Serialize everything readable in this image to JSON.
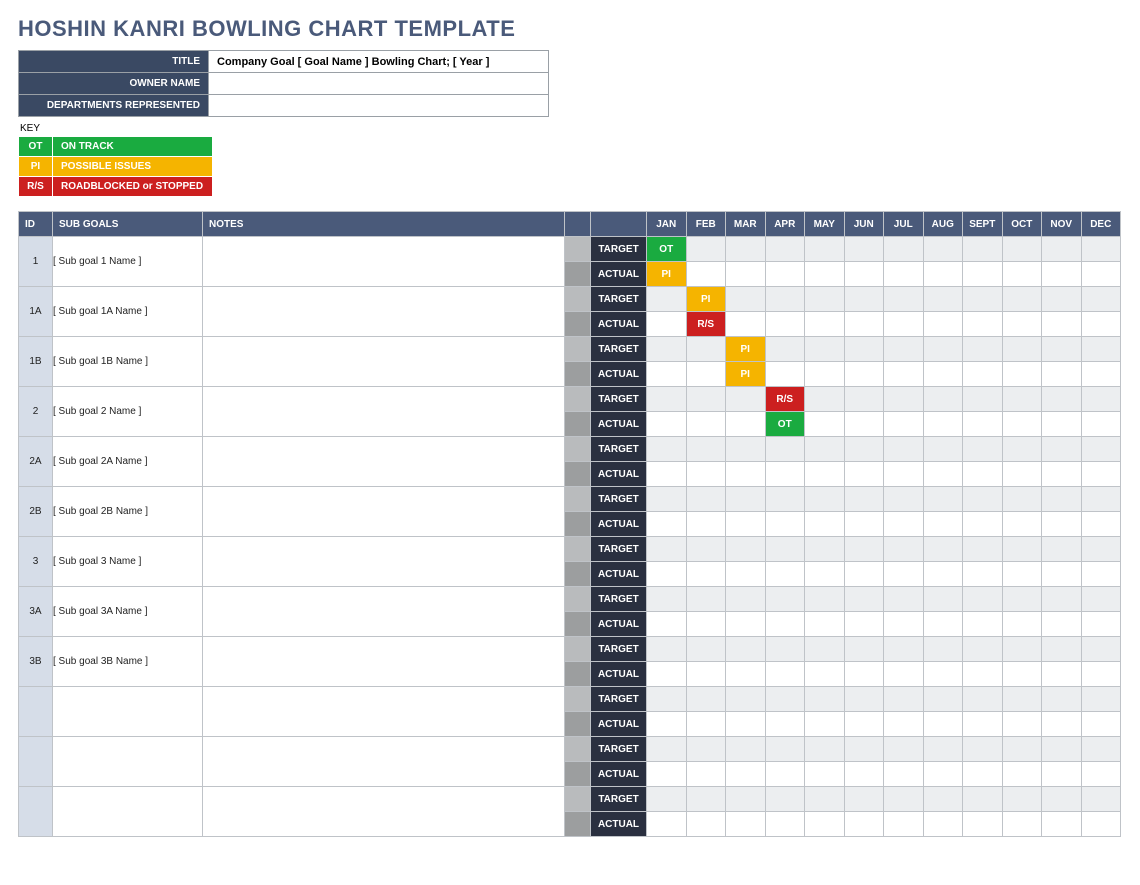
{
  "page_title": "HOSHIN KANRI BOWLING CHART TEMPLATE",
  "meta": {
    "labels": {
      "title": "TITLE",
      "owner": "OWNER NAME",
      "departments": "DEPARTMENTS REPRESENTED"
    },
    "values": {
      "title": "Company Goal [ Goal Name ] Bowling Chart; [ Year ]",
      "owner": "",
      "departments": ""
    }
  },
  "key_label": "KEY",
  "key": [
    {
      "code": "OT",
      "label": "ON TRACK",
      "class": "c-ot"
    },
    {
      "code": "PI",
      "label": "POSSIBLE ISSUES",
      "class": "c-pi"
    },
    {
      "code": "R/S",
      "label": "ROADBLOCKED or STOPPED",
      "class": "c-rs"
    }
  ],
  "grid": {
    "headers": {
      "id": "ID",
      "sub": "SUB GOALS",
      "notes": "NOTES",
      "target": "TARGET",
      "actual": "ACTUAL"
    },
    "months": [
      "JAN",
      "FEB",
      "MAR",
      "APR",
      "MAY",
      "JUN",
      "JUL",
      "AUG",
      "SEPT",
      "OCT",
      "NOV",
      "DEC"
    ],
    "rows": [
      {
        "id": "1",
        "sub": "[ Sub goal 1 Name ]",
        "target": [
          "OT",
          "",
          "",
          "",
          "",
          "",
          "",
          "",
          "",
          "",
          "",
          ""
        ],
        "actual": [
          "PI",
          "",
          "",
          "",
          "",
          "",
          "",
          "",
          "",
          "",
          "",
          ""
        ]
      },
      {
        "id": "1A",
        "sub": "[ Sub goal 1A Name ]",
        "target": [
          "",
          "PI",
          "",
          "",
          "",
          "",
          "",
          "",
          "",
          "",
          "",
          ""
        ],
        "actual": [
          "",
          "R/S",
          "",
          "",
          "",
          "",
          "",
          "",
          "",
          "",
          "",
          ""
        ]
      },
      {
        "id": "1B",
        "sub": "[ Sub goal 1B Name ]",
        "target": [
          "",
          "",
          "PI",
          "",
          "",
          "",
          "",
          "",
          "",
          "",
          "",
          ""
        ],
        "actual": [
          "",
          "",
          "PI",
          "",
          "",
          "",
          "",
          "",
          "",
          "",
          "",
          ""
        ]
      },
      {
        "id": "2",
        "sub": "[ Sub goal 2 Name ]",
        "target": [
          "",
          "",
          "",
          "R/S",
          "",
          "",
          "",
          "",
          "",
          "",
          "",
          ""
        ],
        "actual": [
          "",
          "",
          "",
          "OT",
          "",
          "",
          "",
          "",
          "",
          "",
          "",
          ""
        ]
      },
      {
        "id": "2A",
        "sub": "[ Sub goal 2A Name ]",
        "target": [
          "",
          "",
          "",
          "",
          "",
          "",
          "",
          "",
          "",
          "",
          "",
          ""
        ],
        "actual": [
          "",
          "",
          "",
          "",
          "",
          "",
          "",
          "",
          "",
          "",
          "",
          ""
        ]
      },
      {
        "id": "2B",
        "sub": "[ Sub goal 2B Name ]",
        "target": [
          "",
          "",
          "",
          "",
          "",
          "",
          "",
          "",
          "",
          "",
          "",
          ""
        ],
        "actual": [
          "",
          "",
          "",
          "",
          "",
          "",
          "",
          "",
          "",
          "",
          "",
          ""
        ]
      },
      {
        "id": "3",
        "sub": "[ Sub goal 3 Name ]",
        "target": [
          "",
          "",
          "",
          "",
          "",
          "",
          "",
          "",
          "",
          "",
          "",
          ""
        ],
        "actual": [
          "",
          "",
          "",
          "",
          "",
          "",
          "",
          "",
          "",
          "",
          "",
          ""
        ]
      },
      {
        "id": "3A",
        "sub": "[ Sub goal 3A Name ]",
        "target": [
          "",
          "",
          "",
          "",
          "",
          "",
          "",
          "",
          "",
          "",
          "",
          ""
        ],
        "actual": [
          "",
          "",
          "",
          "",
          "",
          "",
          "",
          "",
          "",
          "",
          "",
          ""
        ]
      },
      {
        "id": "3B",
        "sub": "[ Sub goal 3B Name ]",
        "target": [
          "",
          "",
          "",
          "",
          "",
          "",
          "",
          "",
          "",
          "",
          "",
          ""
        ],
        "actual": [
          "",
          "",
          "",
          "",
          "",
          "",
          "",
          "",
          "",
          "",
          "",
          ""
        ]
      },
      {
        "id": "",
        "sub": "",
        "target": [
          "",
          "",
          "",
          "",
          "",
          "",
          "",
          "",
          "",
          "",
          "",
          ""
        ],
        "actual": [
          "",
          "",
          "",
          "",
          "",
          "",
          "",
          "",
          "",
          "",
          "",
          ""
        ]
      },
      {
        "id": "",
        "sub": "",
        "target": [
          "",
          "",
          "",
          "",
          "",
          "",
          "",
          "",
          "",
          "",
          "",
          ""
        ],
        "actual": [
          "",
          "",
          "",
          "",
          "",
          "",
          "",
          "",
          "",
          "",
          "",
          ""
        ]
      },
      {
        "id": "",
        "sub": "",
        "target": [
          "",
          "",
          "",
          "",
          "",
          "",
          "",
          "",
          "",
          "",
          "",
          ""
        ],
        "actual": [
          "",
          "",
          "",
          "",
          "",
          "",
          "",
          "",
          "",
          "",
          "",
          ""
        ]
      }
    ]
  },
  "chart_data": {
    "type": "table",
    "title": "Hoshin Kanri Bowling Chart Template",
    "months": [
      "JAN",
      "FEB",
      "MAR",
      "APR",
      "MAY",
      "JUN",
      "JUL",
      "AUG",
      "SEPT",
      "OCT",
      "NOV",
      "DEC"
    ],
    "legend": {
      "OT": "ON TRACK",
      "PI": "POSSIBLE ISSUES",
      "R/S": "ROADBLOCKED or STOPPED"
    },
    "series": [
      {
        "name": "Sub goal 1 Target",
        "values": [
          "OT",
          null,
          null,
          null,
          null,
          null,
          null,
          null,
          null,
          null,
          null,
          null
        ]
      },
      {
        "name": "Sub goal 1 Actual",
        "values": [
          "PI",
          null,
          null,
          null,
          null,
          null,
          null,
          null,
          null,
          null,
          null,
          null
        ]
      },
      {
        "name": "Sub goal 1A Target",
        "values": [
          null,
          "PI",
          null,
          null,
          null,
          null,
          null,
          null,
          null,
          null,
          null,
          null
        ]
      },
      {
        "name": "Sub goal 1A Actual",
        "values": [
          null,
          "R/S",
          null,
          null,
          null,
          null,
          null,
          null,
          null,
          null,
          null,
          null
        ]
      },
      {
        "name": "Sub goal 1B Target",
        "values": [
          null,
          null,
          "PI",
          null,
          null,
          null,
          null,
          null,
          null,
          null,
          null,
          null
        ]
      },
      {
        "name": "Sub goal 1B Actual",
        "values": [
          null,
          null,
          "PI",
          null,
          null,
          null,
          null,
          null,
          null,
          null,
          null,
          null
        ]
      },
      {
        "name": "Sub goal 2 Target",
        "values": [
          null,
          null,
          null,
          "R/S",
          null,
          null,
          null,
          null,
          null,
          null,
          null,
          null
        ]
      },
      {
        "name": "Sub goal 2 Actual",
        "values": [
          null,
          null,
          null,
          "OT",
          null,
          null,
          null,
          null,
          null,
          null,
          null,
          null
        ]
      }
    ]
  }
}
